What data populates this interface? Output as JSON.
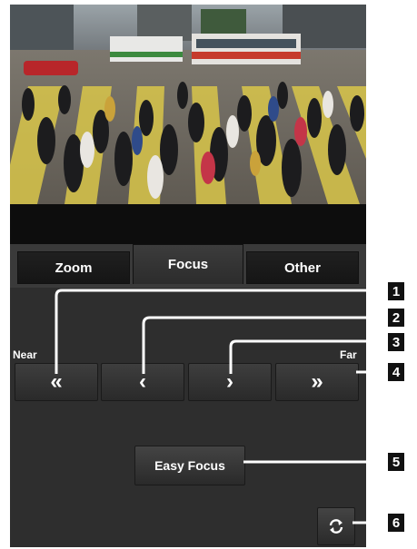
{
  "tabs": [
    {
      "label": "Zoom",
      "active": false
    },
    {
      "label": "Focus",
      "active": true
    },
    {
      "label": "Other",
      "active": false
    }
  ],
  "focus": {
    "near_label": "Near",
    "far_label": "Far",
    "near_fast_icon": "«",
    "near_step_icon": "‹",
    "far_step_icon": "›",
    "far_fast_icon": "»",
    "easy_focus_label": "Easy Focus",
    "refresh_icon": "refresh-icon"
  },
  "callouts": [
    "1",
    "2",
    "3",
    "4",
    "5",
    "6"
  ],
  "colors": {
    "screen_bg": "#2e2e2e",
    "button_bg": "#333333",
    "text": "#ffffff",
    "callout": "#ffffff",
    "badge": "#111111"
  }
}
